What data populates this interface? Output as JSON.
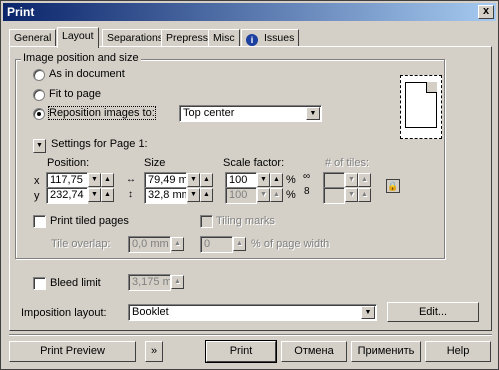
{
  "window": {
    "title": "Print",
    "close_glyph": "x"
  },
  "tabs": [
    {
      "label": "General"
    },
    {
      "label": "Layout"
    },
    {
      "label": "Separations"
    },
    {
      "label": "Prepress"
    },
    {
      "label": "Misc"
    },
    {
      "label": "Issues",
      "icon": "info-icon",
      "icon_glyph": "i"
    }
  ],
  "image_position": {
    "group_label": "Image position and size",
    "as_in_document": "As in document",
    "fit_to_page": "Fit to page",
    "reposition": "Reposition images to:",
    "reposition_value": "Top center",
    "selected": "reposition"
  },
  "settings_page": {
    "label": "Settings for Page 1:"
  },
  "position": {
    "label": "Position:",
    "x_label": "x",
    "x_value": "117,75",
    "y_label": "y",
    "y_value": "232,74"
  },
  "size": {
    "label": "Size",
    "width_value": "79,49 m",
    "height_value": "32,8 mm",
    "width_icon": "horizontal-arrows-icon",
    "height_icon": "vertical-arrows-icon"
  },
  "scale": {
    "label": "Scale factor:",
    "x_value": "100",
    "y_value": "100",
    "unit": "%"
  },
  "tiles": {
    "label": "# of tiles:"
  },
  "print_tiled": {
    "label": "Print tiled pages",
    "tiling_marks": "Tiling marks",
    "tile_overlap_label": "Tile overlap:",
    "tile_overlap_value": "0,0 mm",
    "page_width_value": "0",
    "page_width_suffix": "% of page width"
  },
  "bleed": {
    "label": "Bleed limit",
    "value": "3,175 m"
  },
  "imposition": {
    "label": "Imposition layout:",
    "value": "Booklet",
    "edit_label": "Edit..."
  },
  "footer": {
    "print_preview": "Print Preview",
    "collapse_glyph": "»",
    "print": "Print",
    "cancel": "Отмена",
    "apply": "Применить",
    "help": "Help"
  }
}
